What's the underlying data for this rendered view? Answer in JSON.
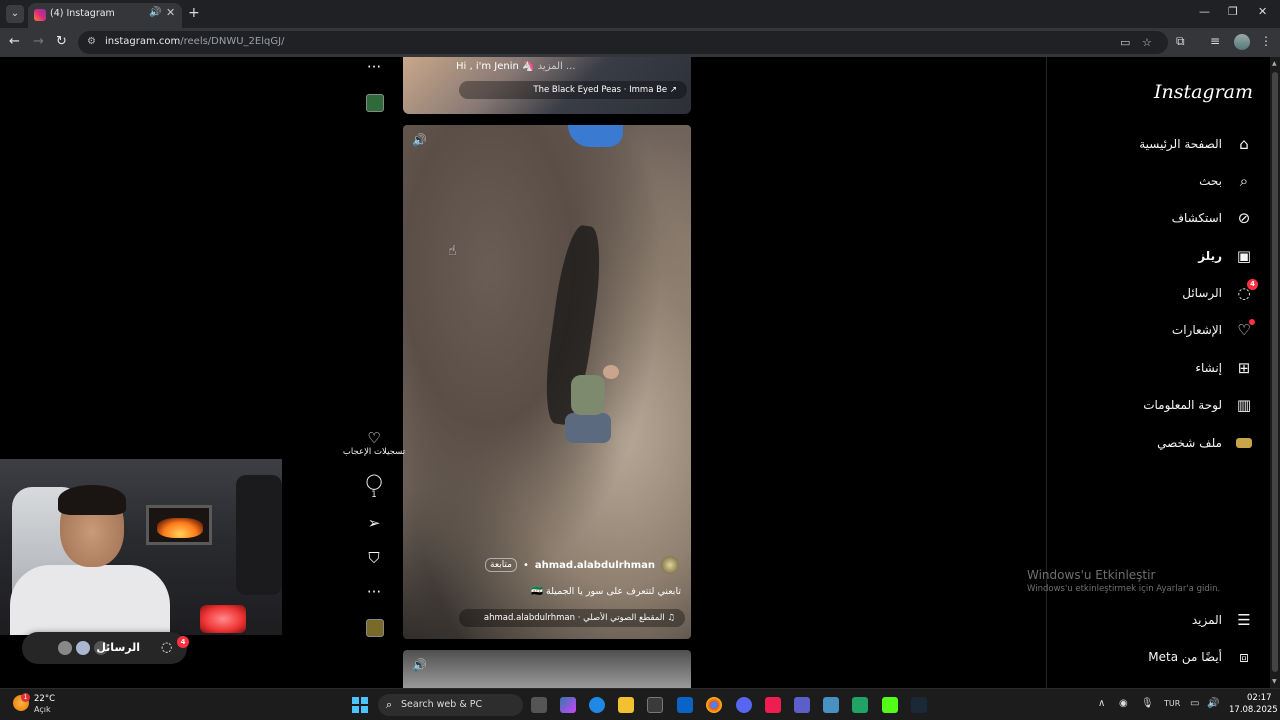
{
  "browser": {
    "tab_title": "(4) Instagram",
    "url_host": "instagram.com",
    "url_path": "/reels/DNWU_2ElqGJ/"
  },
  "reel_prev": {
    "caption_more": "المزيد ...",
    "caption": "Hi , i'm Jenin 🦄",
    "music": "The Black Eyed Peas · Imma Be ↗"
  },
  "reel_main": {
    "author": "ahmad.alabdulrhman",
    "follow": "متابعة",
    "caption": "تابعني لتتعرف على سور يا الجميلة 🇸🇾",
    "music": "ahmad.alabdulrhman · المقطع الصوتي الأصلي ♫"
  },
  "actions": {
    "likes_label": "تسجيلات الإعجاب",
    "comments_count": "1"
  },
  "sidebar": {
    "logo": "Instagram",
    "items": [
      {
        "label": "الصفحة الرئيسية",
        "icon": "home-icon"
      },
      {
        "label": "بحث",
        "icon": "search-icon"
      },
      {
        "label": "استكشاف",
        "icon": "compass-icon"
      },
      {
        "label": "ريلز",
        "icon": "reels-icon"
      },
      {
        "label": "الرسائل",
        "icon": "messenger-icon",
        "badge": "4"
      },
      {
        "label": "الإشعارات",
        "icon": "heart-icon"
      },
      {
        "label": "إنشاء",
        "icon": "plus-square-icon"
      },
      {
        "label": "لوحة المعلومات",
        "icon": "dashboard-icon"
      },
      {
        "label": "ملف شخصي",
        "icon": "profile-avatar"
      }
    ],
    "more": "المزيد",
    "also_from_meta": "أيضًا من Meta"
  },
  "watermark": {
    "title": "Windows'u Etkinleştir",
    "subtitle": "Windows'u etkinleştirmek için Ayarlar'a gidin."
  },
  "messages_chip": {
    "label": "الرسائل",
    "badge": "4"
  },
  "taskbar": {
    "weather_temp": "22°C",
    "weather_desc": "Açık",
    "weather_badge": "1",
    "search_placeholder": "Search web & PC",
    "lang": "TUR",
    "time": "02:17",
    "date": "17.08.2025"
  }
}
